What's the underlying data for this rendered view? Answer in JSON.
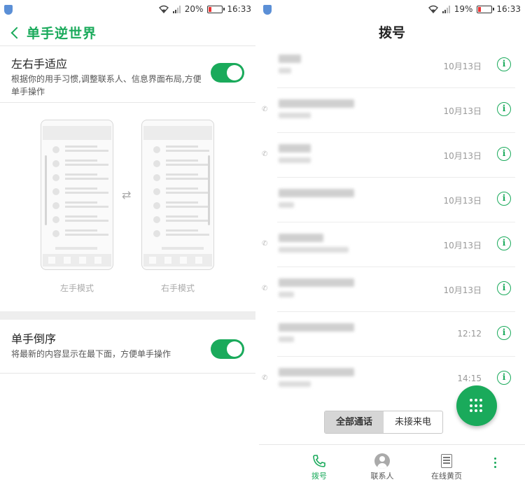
{
  "left": {
    "status": {
      "battery": "20%",
      "time": "16:33"
    },
    "header": {
      "title": "单手逆世界"
    },
    "settings": [
      {
        "title": "左右手适应",
        "desc": "根据你的用手习惯,调整联系人、信息界面布局,方便单手操作",
        "enabled": true
      },
      {
        "title": "单手倒序",
        "desc": "将最新的内容显示在最下面，方便单手操作",
        "enabled": true
      }
    ],
    "modes": {
      "left": "左手模式",
      "right": "右手模式"
    }
  },
  "right": {
    "status": {
      "battery": "19%",
      "time": "16:33"
    },
    "header": {
      "title": "拨号"
    },
    "calls": [
      {
        "time": "10月13日"
      },
      {
        "time": "10月13日"
      },
      {
        "time": "10月13日"
      },
      {
        "time": "10月13日"
      },
      {
        "time": "10月13日"
      },
      {
        "time": "10月13日"
      },
      {
        "time": "12:12"
      },
      {
        "time": "14:15"
      }
    ],
    "filter": {
      "all": "全部通话",
      "missed": "未接来电"
    },
    "tabs": {
      "dial": "拨号",
      "contacts": "联系人",
      "yellow_pages": "在线黄页"
    }
  },
  "colors": {
    "accent": "#1aaa5b"
  }
}
